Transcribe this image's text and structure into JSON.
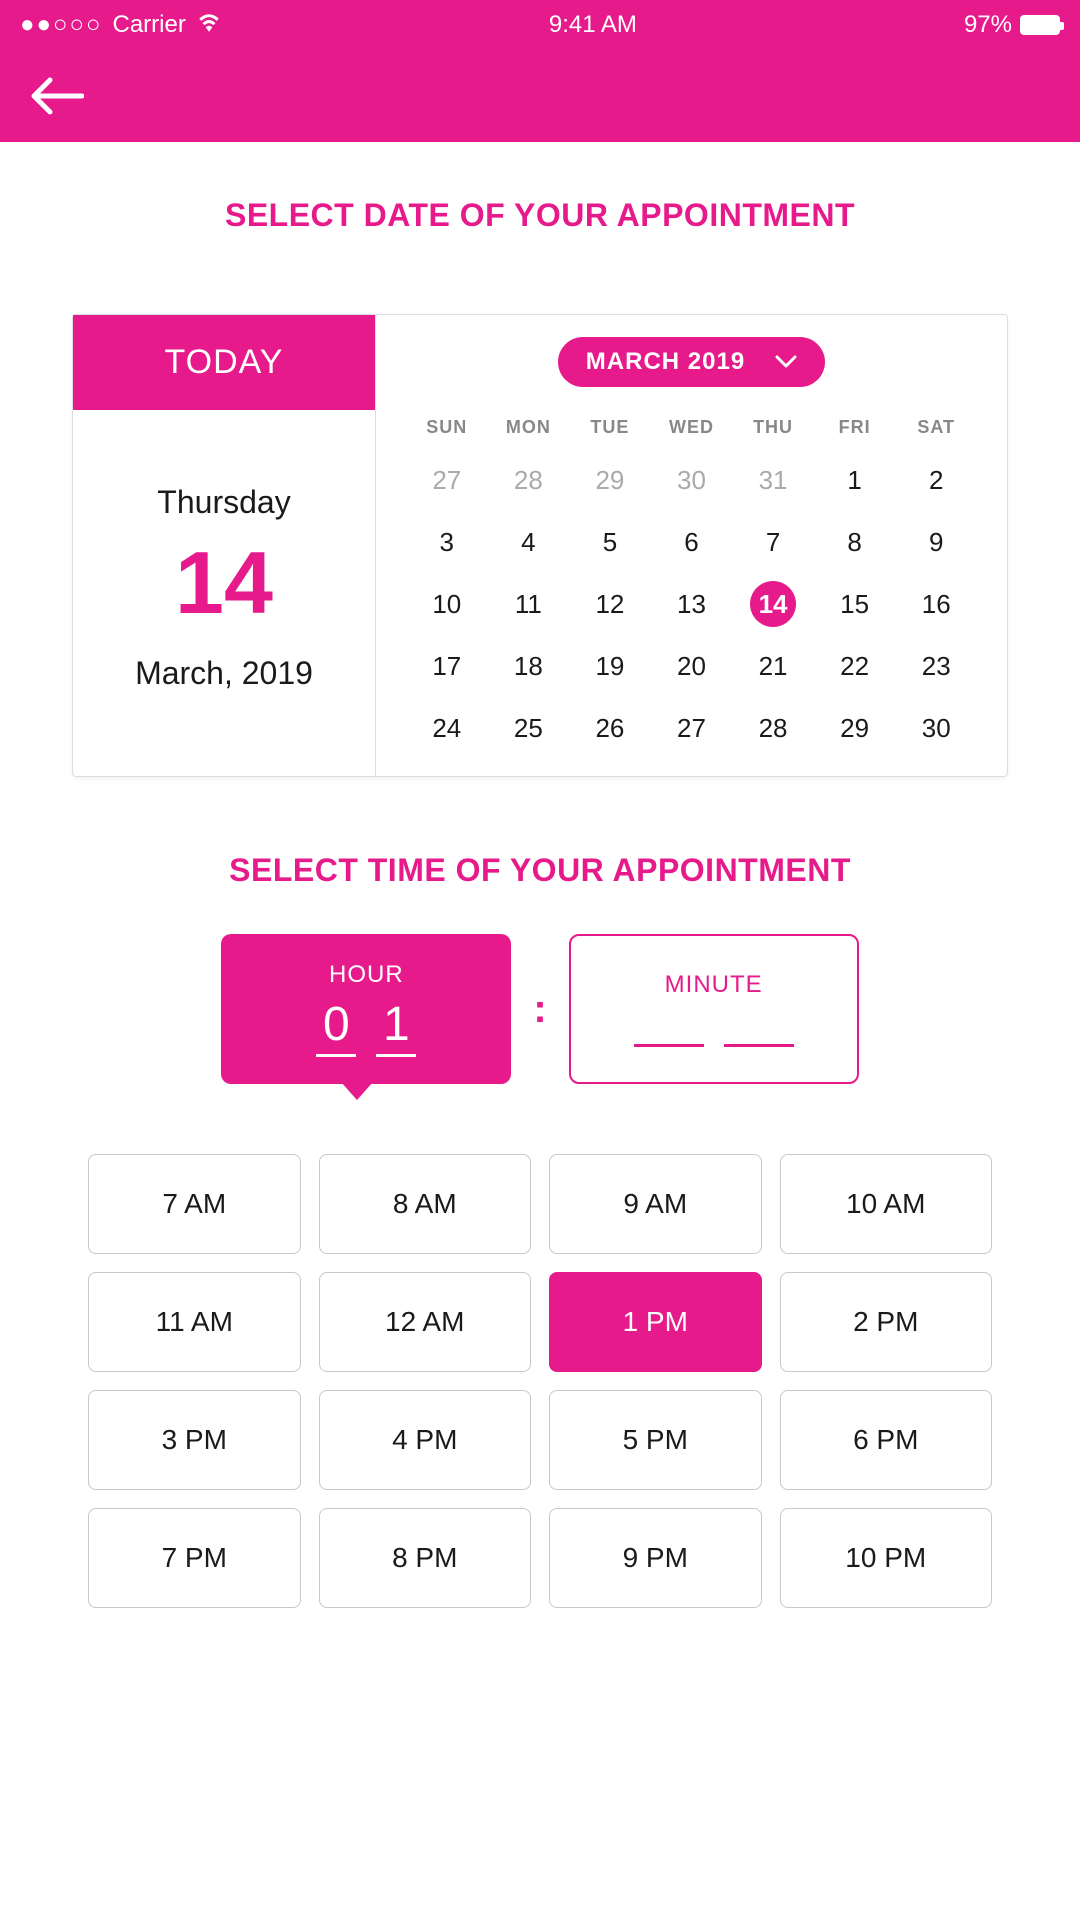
{
  "statusBar": {
    "signal_dots": "●●○○○",
    "carrier": "Carrier",
    "time": "9:41 AM",
    "battery_pct": "97%"
  },
  "sections": {
    "date_title": "SELECT DATE OF YOUR APPOINTMENT",
    "time_title": "SELECT TIME OF YOUR APPOINTMENT"
  },
  "today": {
    "header": "TODAY",
    "weekday": "Thursday",
    "date": "14",
    "month_year": "March, 2019"
  },
  "calendar": {
    "month_label": "MARCH 2019",
    "dow": [
      "SUN",
      "MON",
      "TUE",
      "WED",
      "THU",
      "FRI",
      "SAT"
    ],
    "days": [
      {
        "n": "27",
        "other": true
      },
      {
        "n": "28",
        "other": true
      },
      {
        "n": "29",
        "other": true
      },
      {
        "n": "30",
        "other": true
      },
      {
        "n": "31",
        "other": true
      },
      {
        "n": "1"
      },
      {
        "n": "2"
      },
      {
        "n": "3"
      },
      {
        "n": "4"
      },
      {
        "n": "5"
      },
      {
        "n": "6"
      },
      {
        "n": "7"
      },
      {
        "n": "8"
      },
      {
        "n": "9"
      },
      {
        "n": "10"
      },
      {
        "n": "11"
      },
      {
        "n": "12"
      },
      {
        "n": "13"
      },
      {
        "n": "14",
        "selected": true
      },
      {
        "n": "15"
      },
      {
        "n": "16"
      },
      {
        "n": "17"
      },
      {
        "n": "18"
      },
      {
        "n": "19"
      },
      {
        "n": "20"
      },
      {
        "n": "21"
      },
      {
        "n": "22"
      },
      {
        "n": "23"
      },
      {
        "n": "24"
      },
      {
        "n": "25"
      },
      {
        "n": "26"
      },
      {
        "n": "27"
      },
      {
        "n": "28"
      },
      {
        "n": "29"
      },
      {
        "n": "30"
      }
    ]
  },
  "timePicker": {
    "hour_label": "HOUR",
    "minute_label": "MINUTE",
    "hour_digits": [
      "0",
      "1"
    ],
    "colon": ":"
  },
  "hours": [
    {
      "label": "7 AM"
    },
    {
      "label": "8 AM"
    },
    {
      "label": "9 AM"
    },
    {
      "label": "10 AM"
    },
    {
      "label": "11 AM"
    },
    {
      "label": "12 AM"
    },
    {
      "label": "1 PM",
      "selected": true
    },
    {
      "label": "2 PM"
    },
    {
      "label": "3 PM"
    },
    {
      "label": "4 PM"
    },
    {
      "label": "5 PM"
    },
    {
      "label": "6 PM"
    },
    {
      "label": "7 PM"
    },
    {
      "label": "8 PM"
    },
    {
      "label": "9 PM"
    },
    {
      "label": "10 PM"
    }
  ]
}
